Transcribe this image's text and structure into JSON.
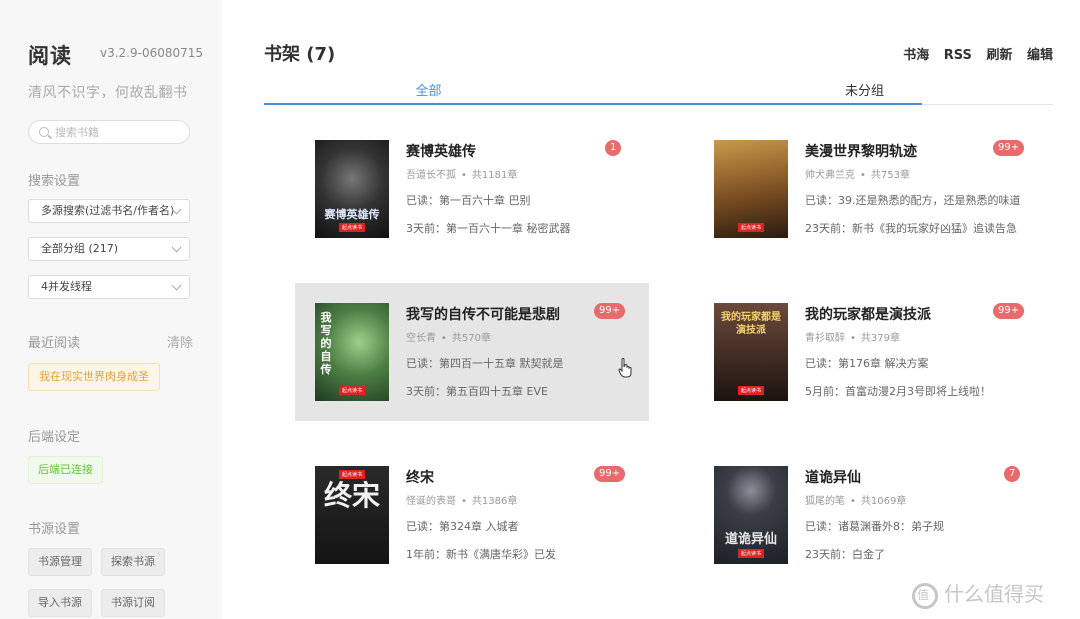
{
  "sidebar": {
    "brand": "阅读",
    "version": "v3.2.9-06080715",
    "motto": "清风不识字，何故乱翻书",
    "search_placeholder": "搜索书籍",
    "search_settings_title": "搜索设置",
    "search_mode": "多源搜索(过滤书名/作者名)",
    "group_select": "全部分组 (217)",
    "threads_select": "4并发线程",
    "recent_title": "最近阅读",
    "recent_clear": "清除",
    "recent_book": "我在现实世界肉身成圣",
    "backend_title": "后端设定",
    "backend_status": "后端已连接",
    "source_title": "书源设置",
    "source_buttons": [
      "书源管理",
      "探索书源",
      "导入书源",
      "书源订阅"
    ]
  },
  "header": {
    "title": "书架 (7)",
    "actions": [
      "书海",
      "RSS",
      "刷新",
      "编辑"
    ]
  },
  "tabs": [
    "全部",
    "未分组"
  ],
  "books": [
    {
      "title": "赛博英雄传",
      "author": "吾道长不孤",
      "chapters": "共1181章",
      "read": "已读：第一百六十章 巴别",
      "latest": "3天前：第一百六十一章 秘密武器",
      "badge": "1",
      "cover_text": "赛博英雄传",
      "cover_bg": "#2a2a2a"
    },
    {
      "title": "美漫世界黎明轨迹",
      "author": "帅犬弗兰克",
      "chapters": "共753章",
      "read": "已读：39.还是熟悉的配方，还是熟悉的味道",
      "latest": "23天前：新书《我的玩家好凶猛》追读告急",
      "badge": "99+",
      "cover_text": "",
      "cover_bg": "#8a5a2a"
    },
    {
      "title": "我写的自传不可能是悲剧",
      "author": "空长青",
      "chapters": "共570章",
      "read": "已读：第四百一十五章 默契就是",
      "latest": "3天前：第五百四十五章 EVE",
      "badge": "99+",
      "cover_text": "我写的自传",
      "cover_bg": "#3e6b3a"
    },
    {
      "title": "我的玩家都是演技派",
      "author": "青衫取醉",
      "chapters": "共379章",
      "read": "已读：第176章 解决方案",
      "latest": "5月前：首富动漫2月3号即将上线啦！",
      "badge": "99+",
      "cover_text": "我的玩家都是演技派",
      "cover_bg": "#5a3a2a"
    },
    {
      "title": "终宋",
      "author": "怪诞的表哥",
      "chapters": "共1386章",
      "read": "已读：第324章 入城者",
      "latest": "1年前：新书《满唐华彩》已发",
      "badge": "99+",
      "cover_text": "终宋",
      "cover_bg": "#1f1f1f"
    },
    {
      "title": "道诡异仙",
      "author": "狐尾的笔",
      "chapters": "共1069章",
      "read": "已读：诸葛渊番外8：弟子规",
      "latest": "23天前：白金了",
      "badge": "7",
      "cover_text": "道诡异仙",
      "cover_bg": "#2c3038"
    }
  ],
  "publisher_mark": "起点读书",
  "watermark": "什么值得买",
  "colors": {
    "accent": "#4a90d9",
    "badge": "#e86a6a",
    "warning": "#e6a23c",
    "success": "#67c23a"
  }
}
